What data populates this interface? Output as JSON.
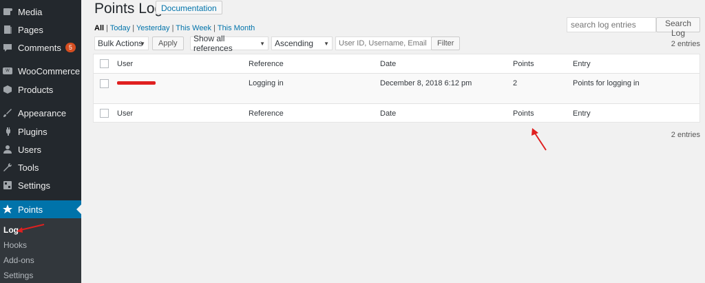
{
  "sidebar": {
    "items": [
      {
        "label": "Media",
        "icon": "media-icon"
      },
      {
        "label": "Pages",
        "icon": "pages-icon"
      },
      {
        "label": "Comments",
        "icon": "comments-icon",
        "badge": "5"
      },
      {
        "label": "WooCommerce",
        "icon": "woocommerce-icon"
      },
      {
        "label": "Products",
        "icon": "products-icon"
      },
      {
        "label": "Appearance",
        "icon": "appearance-icon"
      },
      {
        "label": "Plugins",
        "icon": "plugins-icon"
      },
      {
        "label": "Users",
        "icon": "users-icon"
      },
      {
        "label": "Tools",
        "icon": "tools-icon"
      },
      {
        "label": "Settings",
        "icon": "settings-icon"
      },
      {
        "label": "Points",
        "icon": "star-icon"
      }
    ],
    "submenu": [
      "Log",
      "Hooks",
      "Add-ons",
      "Settings"
    ]
  },
  "header": {
    "title": "Points Log",
    "doc_label": "Documentation"
  },
  "filters": {
    "all": "All",
    "today": "Today",
    "yesterday": "Yesterday",
    "this_week": "This Week",
    "this_month": "This Month"
  },
  "search": {
    "placeholder": "search log entries",
    "button": "Search Log"
  },
  "toolbar": {
    "bulk": "Bulk Actions",
    "apply": "Apply",
    "references": "Show all references",
    "order": "Ascending",
    "user_placeholder": "User ID, Username, Email or",
    "filter": "Filter"
  },
  "entries_text": "2 entries",
  "table": {
    "columns": [
      "User",
      "Reference",
      "Date",
      "Points",
      "Entry"
    ],
    "rows": [
      {
        "user": "",
        "reference": "Logging in",
        "date": "December 8, 2018 6:12 pm",
        "points": "2",
        "entry": "Points for logging in"
      }
    ]
  },
  "colors": {
    "accent": "#0073aa",
    "sidebar": "#23282d",
    "annotation": "#e02020"
  }
}
